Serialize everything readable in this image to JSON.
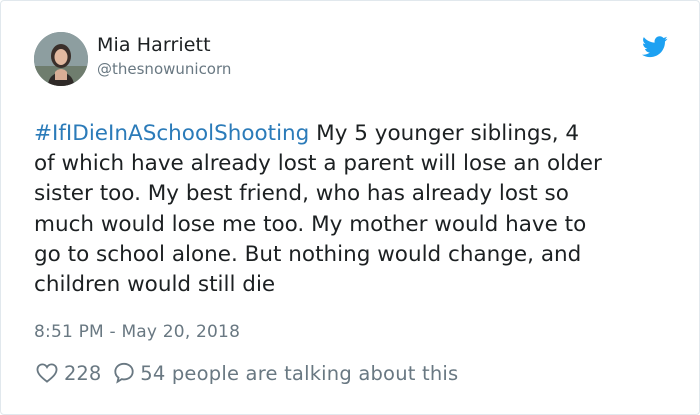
{
  "author": {
    "name": "Mia Harriett",
    "handle": "@thesnowunicorn"
  },
  "tweet": {
    "hashtag": "#IfIDieInASchoolShooting",
    "body": " My 5 younger siblings, 4\nof which have already lost a parent will lose an older\nsister too. My best friend, who has already lost so\nmuch would lose me too. My mother would have to\ngo to school alone. But nothing would change, and\nchildren would still die"
  },
  "timestamp": "8:51 PM - May 20, 2018",
  "engagement": {
    "likes": "228",
    "talking": "54 people are talking about this"
  },
  "icons": {
    "brand": "twitter-bird-icon",
    "like": "heart-icon",
    "reply": "speech-bubble-icon"
  },
  "colors": {
    "hashtag": "#2b7bb9",
    "twitter_blue": "#1da1f2",
    "secondary_text": "#697882"
  }
}
